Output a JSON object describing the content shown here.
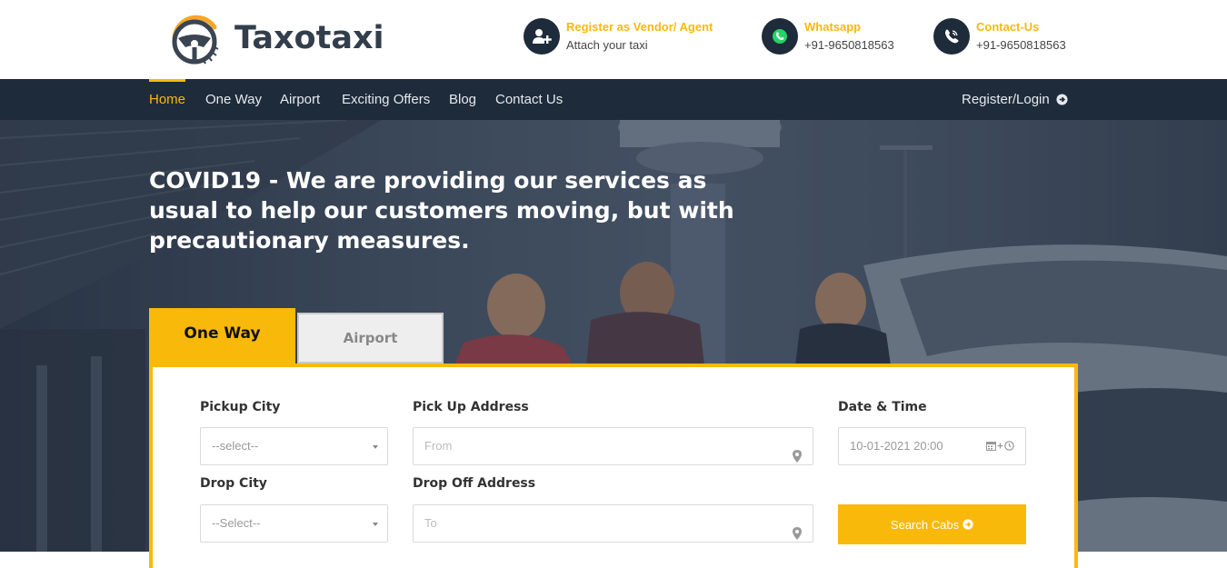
{
  "brand": {
    "name": "Taxotaxi"
  },
  "header_contacts": [
    {
      "title": "Register as Vendor/ Agent",
      "subtitle": "Attach your taxi",
      "icon": "add-user-icon"
    },
    {
      "title": "Whatsapp",
      "subtitle": "+91-9650818563",
      "icon": "whatsapp-icon"
    },
    {
      "title": "Contact-Us",
      "subtitle": "+91-9650818563",
      "icon": "phone-icon"
    }
  ],
  "nav": {
    "items": [
      {
        "label": "Home",
        "active": true
      },
      {
        "label": "One Way",
        "active": false
      },
      {
        "label": "Airport",
        "active": false
      },
      {
        "label": "Exciting Offers",
        "active": false
      },
      {
        "label": "Blog",
        "active": false
      },
      {
        "label": "Contact Us",
        "active": false
      }
    ],
    "login_label": "Register/Login"
  },
  "hero": {
    "title": "COVID19 - We are providing our services as usual to help our customers moving, but with precautionary measures."
  },
  "booking": {
    "tabs": [
      {
        "label": "One Way",
        "active": true
      },
      {
        "label": "Airport",
        "active": false
      }
    ],
    "pickup_city": {
      "label": "Pickup City",
      "value": "--select--"
    },
    "pickup_address": {
      "label": "Pick Up Address",
      "placeholder": "From"
    },
    "date_time": {
      "label": "Date & Time",
      "value": "10-01-2021 20:00"
    },
    "drop_city": {
      "label": "Drop City",
      "value": "--Select--"
    },
    "drop_address": {
      "label": "Drop Off Address",
      "placeholder": "To"
    },
    "search_label": "Search Cabs"
  },
  "colors": {
    "accent": "#f9b90b",
    "nav_bg": "#1e2b3a",
    "text_dark": "#333333"
  }
}
